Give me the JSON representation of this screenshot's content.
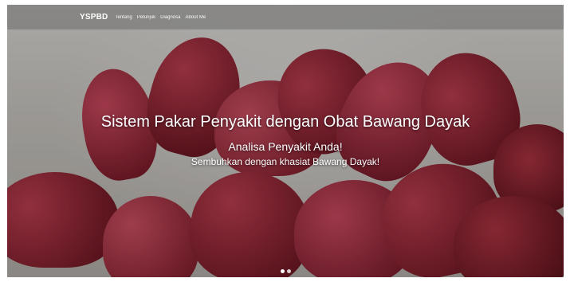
{
  "navbar": {
    "brand": "YSPBD",
    "links": [
      "Tentang",
      "Petunjuk",
      "Diagnosa",
      "About Me"
    ]
  },
  "hero": {
    "title": "Sistem Pakar Penyakit dengan Obat Bawang Dayak",
    "subtitle": "Analisa Penyakit Anda!",
    "tagline": "Sembuhkan dengan khasiat Bawang Dayak!"
  },
  "carousel": {
    "slides": 2,
    "active_index": 0
  },
  "colors": {
    "navbar_bg": "#6e6e6e",
    "bulb_dark": "#5a0f18",
    "bulb_mid": "#8d1e2b",
    "bulb_light": "#b23a4c",
    "background": "#cfcdc9"
  },
  "icons": {
    "carousel-indicator": "dot"
  }
}
